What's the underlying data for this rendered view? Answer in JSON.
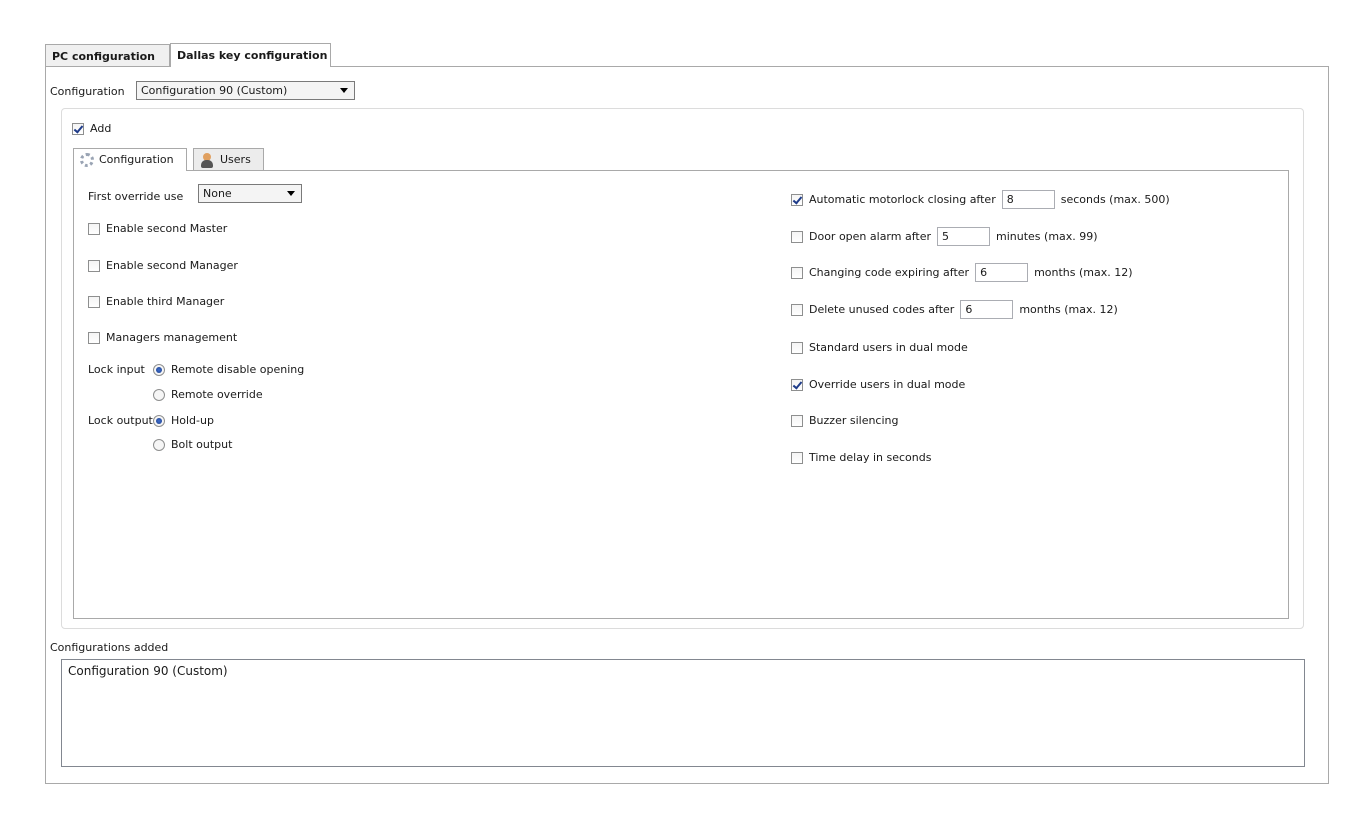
{
  "tabs": [
    {
      "label": "PC configuration",
      "active": false
    },
    {
      "label": "Dallas key configuration",
      "active": true
    }
  ],
  "configuration": {
    "label": "Configuration",
    "selected": "Configuration 90 (Custom)"
  },
  "add": {
    "label": "Add",
    "checked": true
  },
  "inner_tabs": [
    {
      "label": "Configuration",
      "icon": "gear-icon",
      "active": true
    },
    {
      "label": "Users",
      "icon": "user-icon",
      "active": false
    }
  ],
  "left": {
    "first_override": {
      "label": "First override use",
      "selected": "None"
    },
    "checkboxes": [
      {
        "label": "Enable second Master",
        "checked": false
      },
      {
        "label": "Enable second Manager",
        "checked": false
      },
      {
        "label": "Enable third Manager",
        "checked": false
      },
      {
        "label": "Managers management",
        "checked": false
      }
    ],
    "lock_input": {
      "label": "Lock input",
      "options": [
        {
          "label": "Remote disable opening",
          "checked": true
        },
        {
          "label": "Remote override",
          "checked": false
        }
      ]
    },
    "lock_output": {
      "label": "Lock output",
      "options": [
        {
          "label": "Hold-up",
          "checked": true
        },
        {
          "label": "Bolt output",
          "checked": false
        }
      ]
    }
  },
  "right": {
    "motorlock": {
      "label": "Automatic motorlock closing after",
      "value": "8",
      "suffix": "seconds (max. 500)",
      "checked": true
    },
    "door_alarm": {
      "label": "Door open alarm after",
      "value": "5",
      "suffix": "minutes (max. 99)",
      "checked": false
    },
    "code_expiring": {
      "label": "Changing code expiring after",
      "value": "6",
      "suffix": "months (max. 12)",
      "checked": false
    },
    "delete_unused": {
      "label": "Delete unused codes after",
      "value": "6",
      "suffix": "months (max. 12)",
      "checked": false
    },
    "standard_dual": {
      "label": "Standard users in dual mode",
      "checked": false
    },
    "override_dual": {
      "label": "Override users in dual mode",
      "checked": true
    },
    "buzzer": {
      "label": "Buzzer silencing",
      "checked": false
    },
    "time_delay": {
      "label": "Time delay in seconds",
      "checked": false
    }
  },
  "configurations_added": {
    "label": "Configurations added",
    "items": [
      "Configuration 90 (Custom)"
    ]
  }
}
